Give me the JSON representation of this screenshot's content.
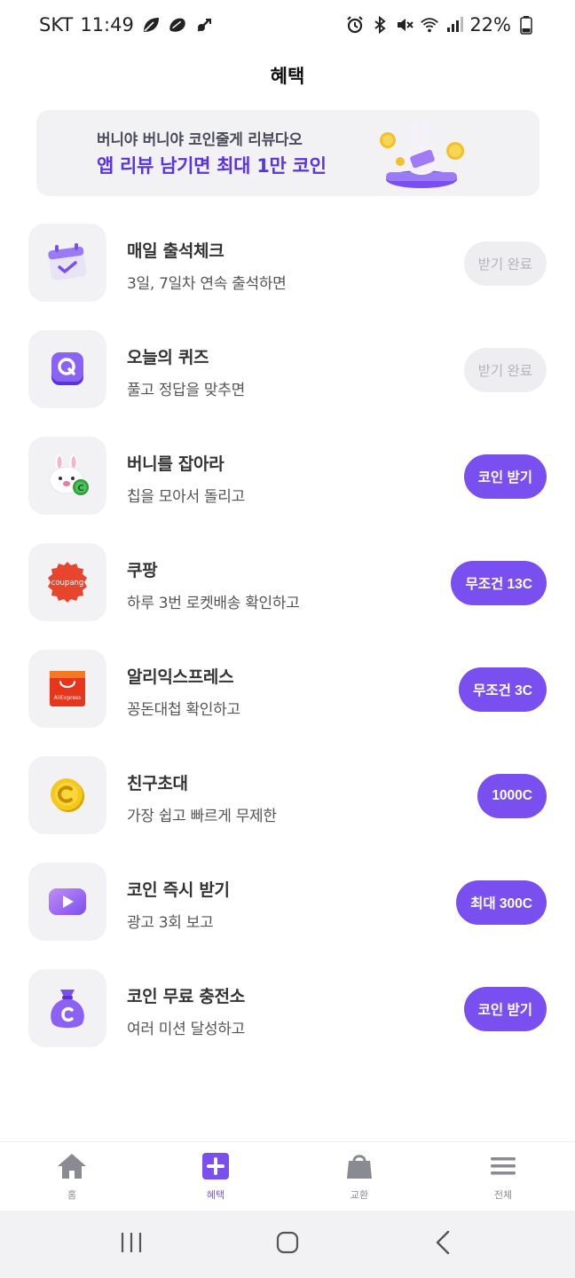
{
  "status_bar": {
    "carrier": "SKT",
    "time": "11:49",
    "battery": "22%",
    "left_icons": [
      "leaf-icon",
      "cloud-leaf-icon",
      "no-bluetooth-like-icon"
    ],
    "right_icons": [
      "alarm-icon",
      "bluetooth-icon",
      "mute-icon",
      "wifi-icon",
      "signal-icon",
      "battery-icon"
    ]
  },
  "header": {
    "title": "혜택"
  },
  "banner": {
    "subtitle": "버니야 버니야 코인줄게 리뷰다오",
    "title": "앱 리뷰 남기면 최대 1만 코인"
  },
  "benefits": [
    {
      "title": "매일 출석체크",
      "subtitle": "3일, 7일차 연속 출석하면",
      "button": "받기 완료",
      "state": "done",
      "icon": "calendar-check-icon"
    },
    {
      "title": "오늘의 퀴즈",
      "subtitle": "풀고 정답을 맞추면",
      "button": "받기 완료",
      "state": "done",
      "icon": "quiz-q-icon"
    },
    {
      "title": "버니를 잡아라",
      "subtitle": "칩을 모아서 돌리고",
      "button": "코인 받기",
      "state": "active",
      "icon": "bunny-icon"
    },
    {
      "title": "쿠팡",
      "subtitle": "하루 3번 로켓배송 확인하고",
      "button": "무조건 13C",
      "state": "active",
      "icon": "coupang-logo-icon",
      "icon_text": "coupang"
    },
    {
      "title": "알리익스프레스",
      "subtitle": "꽁돈대첩 확인하고",
      "button": "무조건 3C",
      "state": "active",
      "icon": "aliexpress-logo-icon",
      "icon_text": "AliExpress"
    },
    {
      "title": "친구초대",
      "subtitle": "가장 쉽고 빠르게 무제한",
      "button": "1000C",
      "state": "active",
      "icon": "gold-coin-icon"
    },
    {
      "title": "코인 즉시 받기",
      "subtitle": "광고 3회 보고",
      "button": "최대 300C",
      "state": "active",
      "icon": "video-play-icon"
    },
    {
      "title": "코인 무료 충전소",
      "subtitle": "여러 미션 달성하고",
      "button": "코인 받기",
      "state": "active",
      "icon": "coin-bag-icon"
    }
  ],
  "bottom_nav": [
    {
      "label": "홈",
      "icon": "home-icon",
      "active": false
    },
    {
      "label": "혜택",
      "icon": "plus-square-icon",
      "active": true
    },
    {
      "label": "교환",
      "icon": "shopping-bag-icon",
      "active": false
    },
    {
      "label": "전체",
      "icon": "menu-icon",
      "active": false
    }
  ],
  "colors": {
    "accent": "#7a4ff0",
    "banner_text": "#5a34e0",
    "done_bg": "#eeeef0",
    "card_bg": "#f2f2f5"
  }
}
